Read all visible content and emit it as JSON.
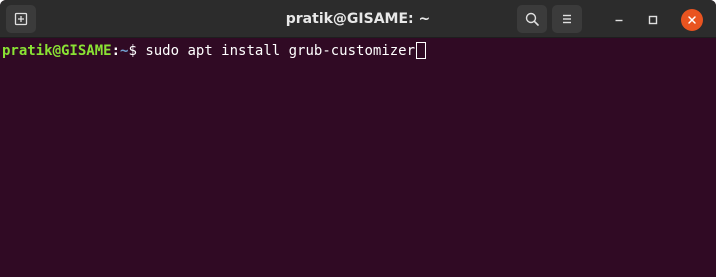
{
  "window": {
    "title": "pratik@GISAME: ~"
  },
  "titlebar_icons": {
    "new_tab": "new-tab-icon",
    "search": "search-icon",
    "menu": "hamburger-menu-icon",
    "minimize": "minimize-icon",
    "maximize": "maximize-icon",
    "close": "close-icon"
  },
  "colors": {
    "terminal_background": "#300a24",
    "titlebar_background": "#2c2c2c",
    "prompt_user": "#8ae234",
    "prompt_path": "#729fcf",
    "close_button": "#e95420"
  },
  "terminal": {
    "prompt_user_host": "pratik@GISAME",
    "prompt_colon": ":",
    "prompt_path": "~",
    "prompt_symbol": "$ ",
    "command": "sudo apt install grub-customizer"
  }
}
